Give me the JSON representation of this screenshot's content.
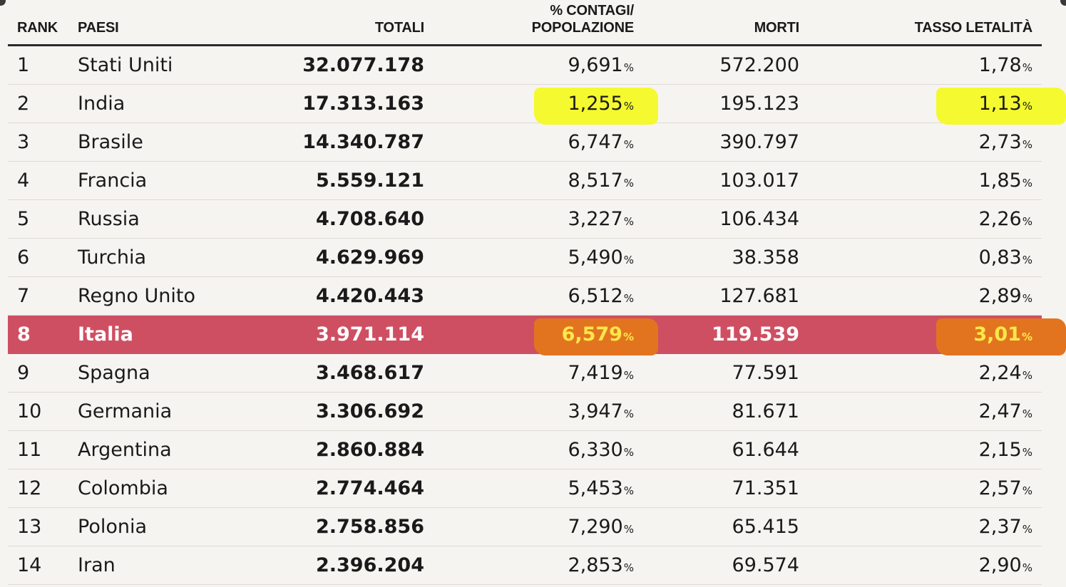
{
  "table": {
    "headers": {
      "rank": "RANK",
      "paesi": "PAESI",
      "totali": "TOTALI",
      "contagi": "% CONTAGI/\nPOPOLAZIONE",
      "morti": "MORTI",
      "tasso": "TASSO LETALITÀ"
    },
    "percent_sign": "%",
    "rows": [
      {
        "rank": "1",
        "paese": "Stati Uniti",
        "totali": "32.077.178",
        "contagi": "9,691",
        "morti": "572.200",
        "tasso": "1,78"
      },
      {
        "rank": "2",
        "paese": "India",
        "totali": "17.313.163",
        "contagi": "1,255",
        "morti": "195.123",
        "tasso": "1,13"
      },
      {
        "rank": "3",
        "paese": "Brasile",
        "totali": "14.340.787",
        "contagi": "6,747",
        "morti": "390.797",
        "tasso": "2,73"
      },
      {
        "rank": "4",
        "paese": "Francia",
        "totali": "5.559.121",
        "contagi": "8,517",
        "morti": "103.017",
        "tasso": "1,85"
      },
      {
        "rank": "5",
        "paese": "Russia",
        "totali": "4.708.640",
        "contagi": "3,227",
        "morti": "106.434",
        "tasso": "2,26"
      },
      {
        "rank": "6",
        "paese": "Turchia",
        "totali": "4.629.969",
        "contagi": "5,490",
        "morti": "38.358",
        "tasso": "0,83"
      },
      {
        "rank": "7",
        "paese": "Regno Unito",
        "totali": "4.420.443",
        "contagi": "6,512",
        "morti": "127.681",
        "tasso": "2,89"
      },
      {
        "rank": "8",
        "paese": "Italia",
        "totali": "3.971.114",
        "contagi": "6,579",
        "morti": "119.539",
        "tasso": "3,01"
      },
      {
        "rank": "9",
        "paese": "Spagna",
        "totali": "3.468.617",
        "contagi": "7,419",
        "morti": "77.591",
        "tasso": "2,24"
      },
      {
        "rank": "10",
        "paese": "Germania",
        "totali": "3.306.692",
        "contagi": "3,947",
        "morti": "81.671",
        "tasso": "2,47"
      },
      {
        "rank": "11",
        "paese": "Argentina",
        "totali": "2.860.884",
        "contagi": "6,330",
        "morti": "61.644",
        "tasso": "2,15"
      },
      {
        "rank": "12",
        "paese": "Colombia",
        "totali": "2.774.464",
        "contagi": "5,453",
        "morti": "71.351",
        "tasso": "2,57"
      },
      {
        "rank": "13",
        "paese": "Polonia",
        "totali": "2.758.856",
        "contagi": "7,290",
        "morti": "65.415",
        "tasso": "2,37"
      },
      {
        "rank": "14",
        "paese": "Iran",
        "totali": "2.396.204",
        "contagi": "2,853",
        "morti": "69.574",
        "tasso": "2,90"
      }
    ],
    "highlighted_row_rank": "8",
    "marker_highlights": [
      {
        "rank": "2",
        "column": "contagi",
        "color": "#f4fa2f"
      },
      {
        "rank": "2",
        "column": "tasso",
        "color": "#f4fa2f"
      },
      {
        "rank": "8",
        "column": "contagi",
        "color": "#e3741f"
      },
      {
        "rank": "8",
        "column": "tasso",
        "color": "#e3741f"
      }
    ]
  },
  "colors": {
    "background": "#f6f4f1",
    "highlight_row": "#cf4f62",
    "marker_yellow": "#f4fa2f",
    "marker_orange": "#e3741f",
    "text": "#1a1a1a"
  }
}
